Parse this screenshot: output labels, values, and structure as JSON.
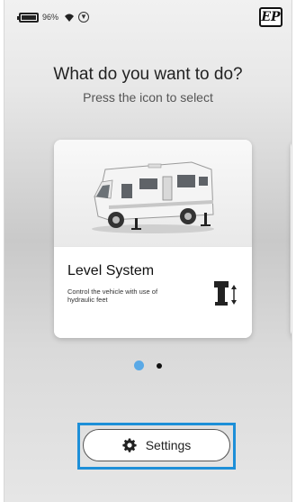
{
  "status_bar": {
    "battery_percent": "96%",
    "wifi_icon": "wifi-icon",
    "download_icon": "download-icon",
    "download_glyph": "▼",
    "logo_text": "EP"
  },
  "prompt": {
    "title": "What do you want to do?",
    "subtitle": "Press the icon to select"
  },
  "cards": [
    {
      "title": "Level System",
      "description": "Control the vehicle with use of hydraulic feet",
      "image": "motorhome-image",
      "icon": "hydraulic-foot-icon"
    }
  ],
  "pagination": {
    "total": 2,
    "active_index": 0,
    "active_color": "#5aa9e6"
  },
  "settings": {
    "label": "Settings",
    "icon": "gear-icon",
    "highlight_color": "#1d8fd8"
  }
}
